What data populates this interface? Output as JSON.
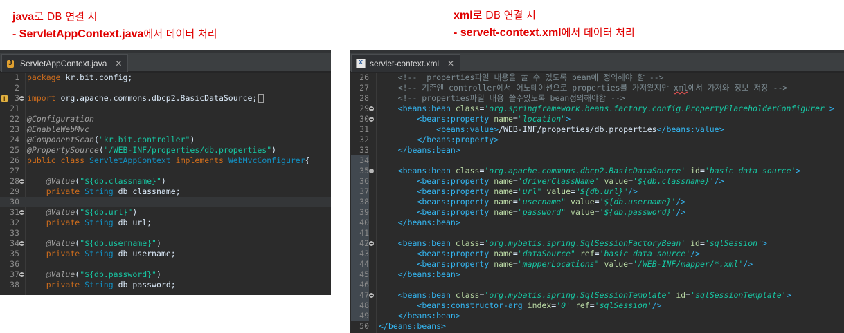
{
  "captions": {
    "left": {
      "line1_strong": "java",
      "line1_rest": "로 DB 연결 시",
      "line2_strong": "- ServletAppContext.java",
      "line2_rest": "에서 데이터 처리"
    },
    "right": {
      "line1_strong": "xml",
      "line1_rest": "로 DB 연결 시",
      "line2_strong": "- servelt-context.xml",
      "line2_rest": "에서 데이터 처리"
    }
  },
  "left_editor": {
    "tab_label": "ServletAppContext.java",
    "lines": [
      {
        "n": "1",
        "t": "package kr.bit.config;"
      },
      {
        "n": "2",
        "t": ""
      },
      {
        "n": "3",
        "t": "import org.apache.commons.dbcp2.BasicDataSource;"
      },
      {
        "n": "21",
        "t": ""
      },
      {
        "n": "22",
        "t": "@Configuration"
      },
      {
        "n": "23",
        "t": "@EnableWebMvc"
      },
      {
        "n": "24",
        "t": "@ComponentScan(\"kr.bit.controller\")"
      },
      {
        "n": "25",
        "t": "@PropertySource(\"/WEB-INF/properties/db.properties\")"
      },
      {
        "n": "26",
        "t": "public class ServletAppContext implements WebMvcConfigurer{"
      },
      {
        "n": "27",
        "t": ""
      },
      {
        "n": "28",
        "t": "@Value(\"${db.classname}\")"
      },
      {
        "n": "29",
        "t": "private String db_classname;"
      },
      {
        "n": "30",
        "t": ""
      },
      {
        "n": "31",
        "t": "@Value(\"${db.url}\")"
      },
      {
        "n": "32",
        "t": "private String db_url;"
      },
      {
        "n": "33",
        "t": ""
      },
      {
        "n": "34",
        "t": "@Value(\"${db.username}\")"
      },
      {
        "n": "35",
        "t": "private String db_username;"
      },
      {
        "n": "36",
        "t": ""
      },
      {
        "n": "37",
        "t": "@Value(\"${db.password}\")"
      },
      {
        "n": "38",
        "t": "private String db_password;"
      }
    ]
  },
  "right_editor": {
    "tab_label": "servlet-context.xml",
    "lines": [
      {
        "n": "26",
        "t": "<!--  properties파일 내용을 쓸 수 있도록 bean에 정의해야 함 -->"
      },
      {
        "n": "27",
        "t": "<!-- 기존엔 controller에서 어노테이션으로 properties를 가져왔지만 xml에서 가져와 정보 저장 -->"
      },
      {
        "n": "28",
        "t": "<!-- properties파일 내용 쓸수있도록 bean정의해야함 -->"
      },
      {
        "n": "29",
        "t": "<beans:bean class='org.springframework.beans.factory.config.PropertyPlaceholderConfigurer'>"
      },
      {
        "n": "30",
        "t": "<beans:property name=\"location\">"
      },
      {
        "n": "31",
        "t": "<beans:value>/WEB-INF/properties/db.properties</beans:value>"
      },
      {
        "n": "32",
        "t": "</beans:property>"
      },
      {
        "n": "33",
        "t": "</beans:bean>"
      },
      {
        "n": "34",
        "t": ""
      },
      {
        "n": "35",
        "t": "<beans:bean class='org.apache.commons.dbcp2.BasicDataSource' id='basic_data_source'>"
      },
      {
        "n": "36",
        "t": "<beans:property name='driverClassName' value='${db.classname}'/>"
      },
      {
        "n": "37",
        "t": "<beans:property name=\"url\" value=\"${db.url}\"/>"
      },
      {
        "n": "38",
        "t": "<beans:property name=\"username\" value='${db.username}'/>"
      },
      {
        "n": "39",
        "t": "<beans:property name=\"password\" value='${db.password}'/>"
      },
      {
        "n": "40",
        "t": "</beans:bean>"
      },
      {
        "n": "41",
        "t": ""
      },
      {
        "n": "42",
        "t": "<beans:bean class='org.mybatis.spring.SqlSessionFactoryBean' id='sqlSession'>"
      },
      {
        "n": "43",
        "t": "<beans:property name=\"dataSource\" ref='basic_data_source'/>"
      },
      {
        "n": "44",
        "t": "<beans:property name=\"mapperLocations\" value='/WEB-INF/mapper/*.xml'/>"
      },
      {
        "n": "45",
        "t": "</beans:bean>"
      },
      {
        "n": "46",
        "t": ""
      },
      {
        "n": "47",
        "t": "<beans:bean class='org.mybatis.spring.SqlSessionTemplate' id='sqlSessionTemplate'>"
      },
      {
        "n": "48",
        "t": "<beans:constructor-arg index='0' ref='sqlSession'/>"
      },
      {
        "n": "49",
        "t": "</beans:bean>"
      },
      {
        "n": "50",
        "t": "</beans:beans>"
      }
    ]
  },
  "colors": {
    "caption": "#e00000",
    "editor_bg": "#2b2b2b",
    "keyword": "#cc6c1d",
    "string": "#17c6a3",
    "tag": "#34b5f0"
  }
}
